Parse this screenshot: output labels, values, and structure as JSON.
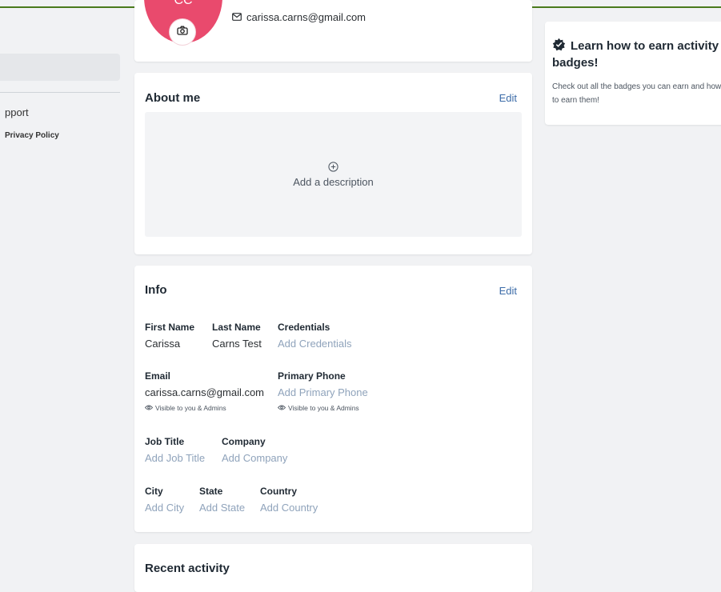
{
  "sidebar": {
    "support_label": "pport",
    "privacy_label": "Privacy Policy"
  },
  "profile": {
    "initials": "CC",
    "email": "carissa.carns@gmail.com"
  },
  "about": {
    "title": "About me",
    "edit_label": "Edit",
    "add_description_label": "Add a description"
  },
  "info": {
    "title": "Info",
    "edit_label": "Edit",
    "first_name": {
      "label": "First Name",
      "value": "Carissa"
    },
    "last_name": {
      "label": "Last Name",
      "value": "Carns Test"
    },
    "credentials": {
      "label": "Credentials",
      "placeholder": "Add Credentials"
    },
    "email": {
      "label": "Email",
      "value": "carissa.carns@gmail.com",
      "visibility": "Visible to you & Admins"
    },
    "primary_phone": {
      "label": "Primary Phone",
      "placeholder": "Add Primary Phone",
      "visibility": "Visible to you & Admins"
    },
    "job_title": {
      "label": "Job Title",
      "placeholder": "Add Job Title"
    },
    "company": {
      "label": "Company",
      "placeholder": "Add Company"
    },
    "city": {
      "label": "City",
      "placeholder": "Add City"
    },
    "state": {
      "label": "State",
      "placeholder": "Add State"
    },
    "country": {
      "label": "Country",
      "placeholder": "Add Country"
    }
  },
  "recent_activity": {
    "title": "Recent activity"
  },
  "badges": {
    "title": "Learn how to earn activity badges!",
    "description": "Check out all the badges you can earn and how to earn them!"
  },
  "colors": {
    "accent_link": "#3c6ca8",
    "avatar_bg": "#e94a6d",
    "top_border": "#4a7a1c",
    "placeholder_text": "#8fa3bb"
  },
  "icons": {
    "camera": "camera-icon",
    "mail": "mail-icon",
    "add": "plus-circle-icon",
    "eye": "eye-icon",
    "badge": "badge-icon"
  }
}
